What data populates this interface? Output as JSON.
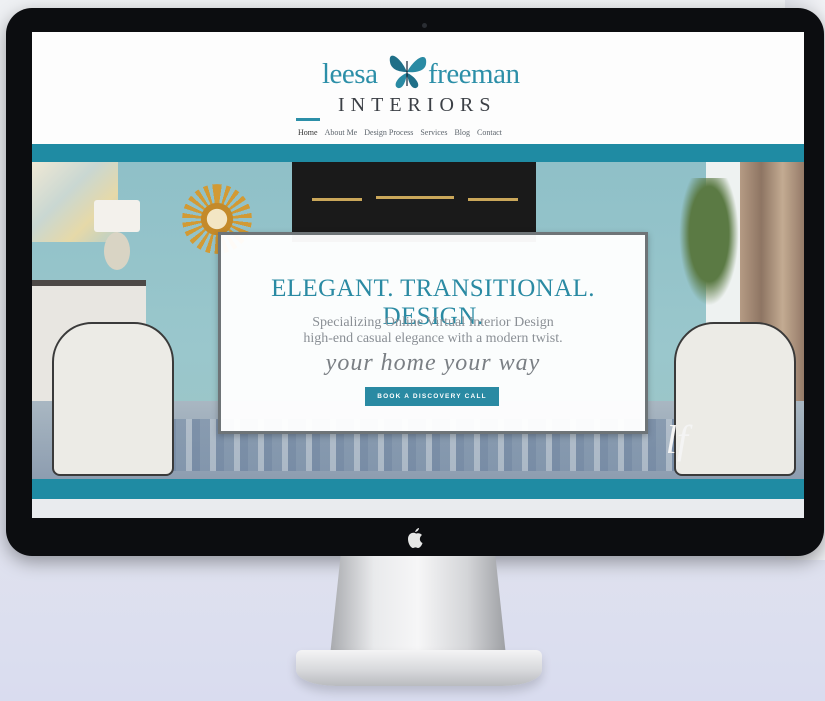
{
  "brand": {
    "word_left": "leesa",
    "word_right": "freeman",
    "word_bottom": "INTERIORS",
    "accent_color": "#2c8fa8",
    "icon": "butterfly-icon"
  },
  "nav": {
    "items": [
      "Home",
      "About Me",
      "Design Process",
      "Services",
      "Blog",
      "Contact"
    ],
    "active": "Home"
  },
  "hero": {
    "title": "ELEGANT. TRANSITIONAL. DESIGN.",
    "subtitle_line1": "Specializing Online Virtual Interior Design",
    "subtitle_line2": "high-end casual elegance with a modern twist.",
    "script_tagline": "your home your way",
    "cta_label": "BOOK A DISCOVERY CALL",
    "monogram": "lf"
  },
  "device": {
    "logo_icon": "apple-logo-icon"
  }
}
